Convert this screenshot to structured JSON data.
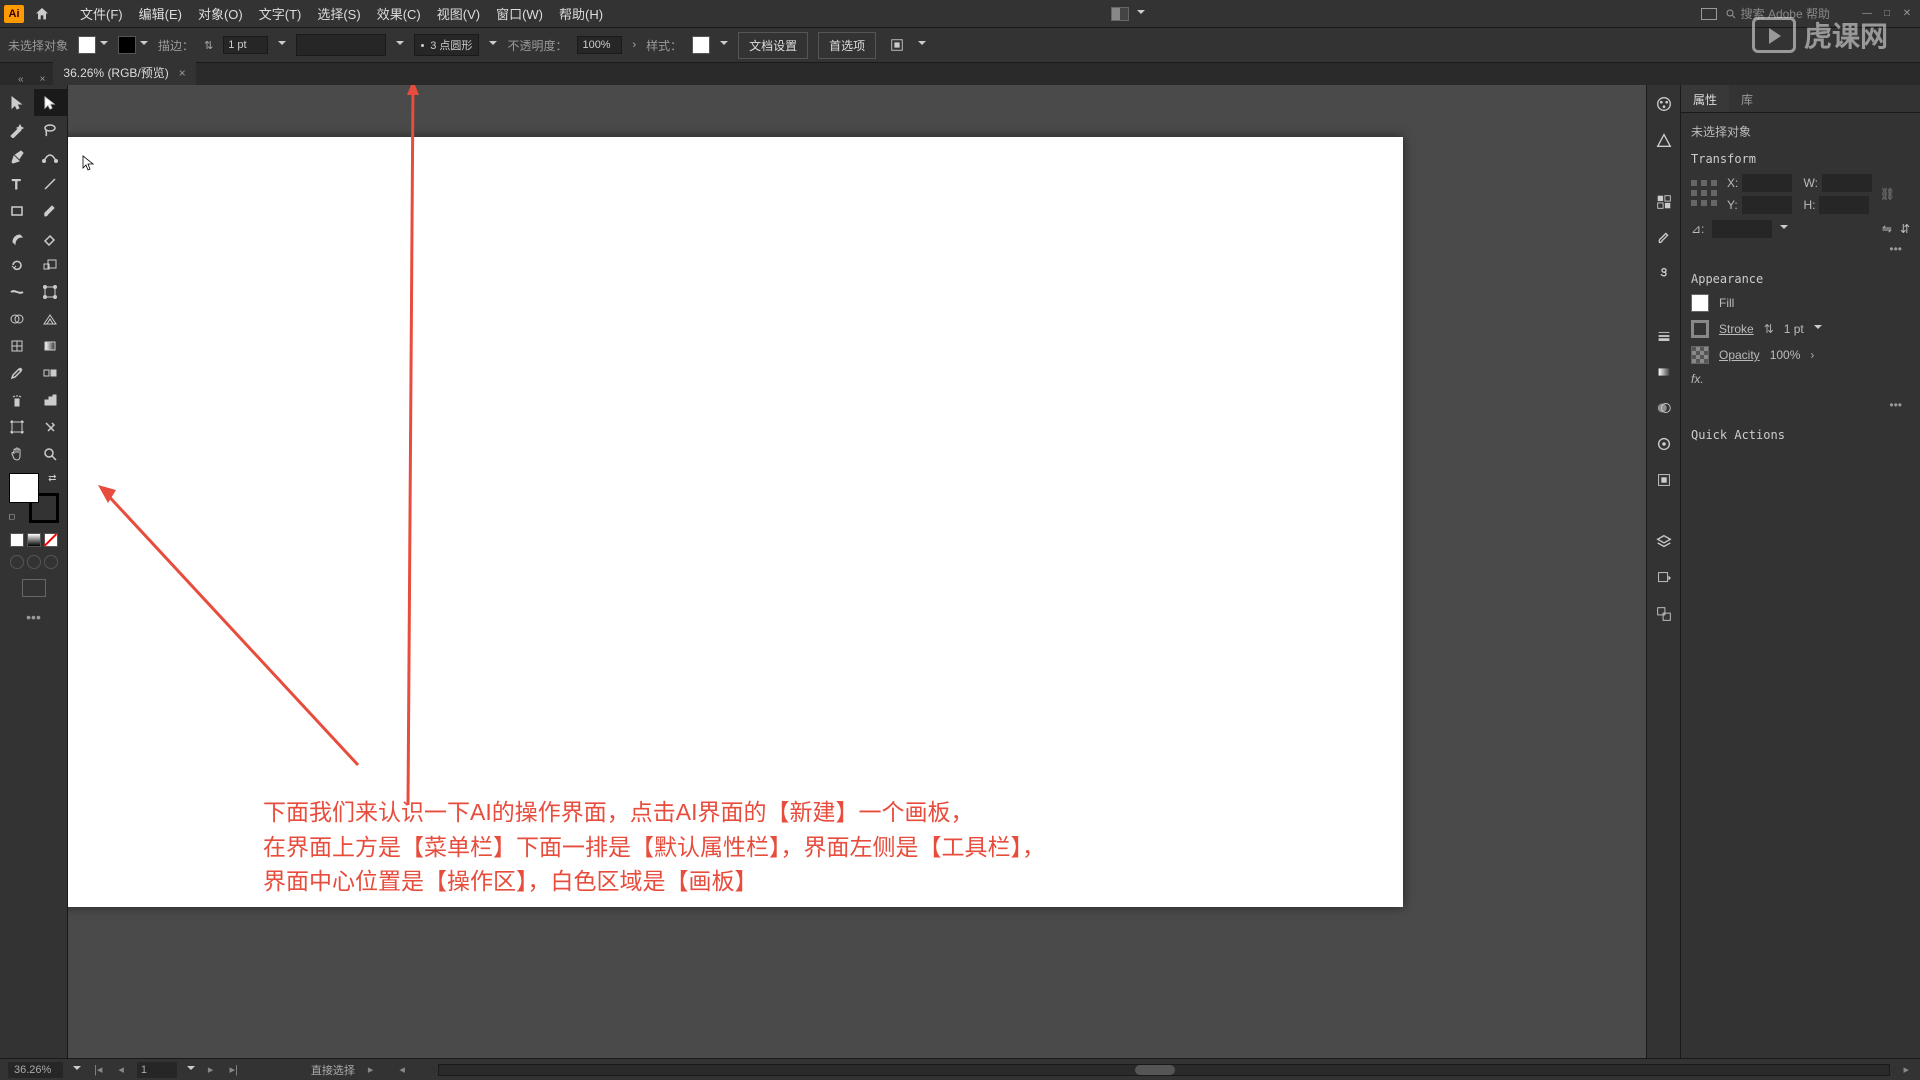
{
  "app": {
    "icon_text": "Ai"
  },
  "menu": {
    "items": [
      "文件(F)",
      "编辑(E)",
      "对象(O)",
      "文字(T)",
      "选择(S)",
      "效果(C)",
      "视图(V)",
      "窗口(W)",
      "帮助(H)"
    ]
  },
  "search": {
    "placeholder": "搜索 Adobe 帮助"
  },
  "control": {
    "no_selection": "未选择对象",
    "stroke_label": "描边：",
    "stroke_value": "1 pt",
    "brush_label": "3 点圆形",
    "opacity_label": "不透明度：",
    "opacity_value": "100%",
    "style_label": "样式：",
    "doc_setup": "文档设置",
    "prefs": "首选项"
  },
  "tab": {
    "title": "36.26% (RGB/预览)"
  },
  "annotation": {
    "line1": "下面我们来认识一下AI的操作界面，点击AI界面的【新建】一个画板，",
    "line2": "在界面上方是【菜单栏】下面一排是【默认属性栏】，界面左侧是【工具栏】，",
    "line3": "界面中心位置是【操作区】，白色区域是【画板】"
  },
  "panel": {
    "tab_props": "属性",
    "tab_lib": "库",
    "no_selection": "未选择对象",
    "transform": "Transform",
    "x_label": "X:",
    "y_label": "Y:",
    "w_label": "W:",
    "h_label": "H:",
    "angle_label": "⊿:",
    "appearance": "Appearance",
    "fill": "Fill",
    "stroke": "Stroke",
    "stroke_val": "1 pt",
    "opacity": "Opacity",
    "opacity_val": "100%",
    "fx": "fx.",
    "quick": "Quick Actions"
  },
  "status": {
    "zoom": "36.26%",
    "artboard": "1",
    "tool": "直接选择"
  },
  "watermark": "虎课网"
}
